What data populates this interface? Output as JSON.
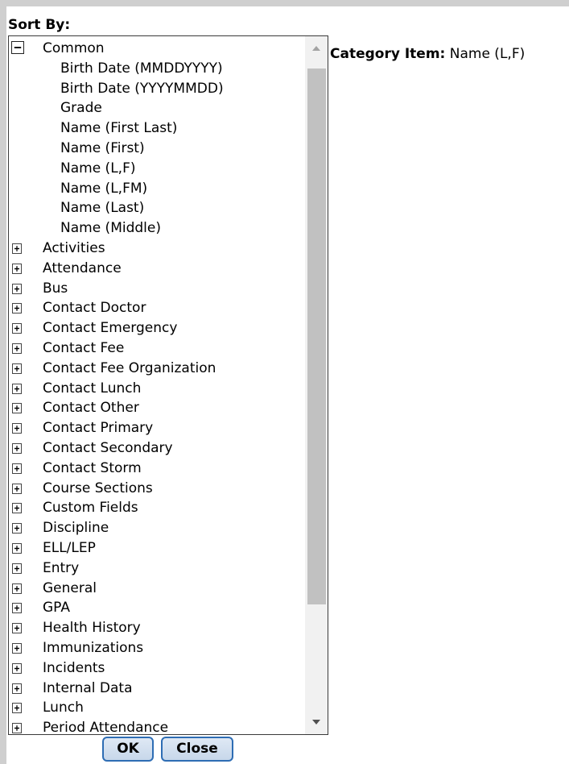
{
  "sort_by": {
    "label": "Sort By:"
  },
  "tree": {
    "expanded_category": "Common",
    "common_items": [
      "Birth Date (MMDDYYYY)",
      "Birth Date (YYYYMMDD)",
      "Grade",
      "Name (First Last)",
      "Name (First)",
      "Name (L,F)",
      "Name (L,FM)",
      "Name (Last)",
      "Name (Middle)"
    ],
    "collapsed_categories": [
      "Activities",
      "Attendance",
      "Bus",
      "Contact Doctor",
      "Contact Emergency",
      "Contact Fee",
      "Contact Fee Organization",
      "Contact Lunch",
      "Contact Other",
      "Contact Primary",
      "Contact Secondary",
      "Contact Storm",
      "Course Sections",
      "Custom Fields",
      "Discipline",
      "ELL/LEP",
      "Entry",
      "General",
      "GPA",
      "Health History",
      "Immunizations",
      "Incidents",
      "Internal Data",
      "Lunch",
      "Period Attendance"
    ],
    "icons": {
      "expanded": "minus-box-icon",
      "collapsed": "plus-box-icon"
    }
  },
  "category_item": {
    "label": "Category Item:",
    "value": "Name (L,F)"
  },
  "buttons": {
    "ok": "OK",
    "close": "Close"
  },
  "colors": {
    "button_border": "#2e6db4",
    "scroll_thumb": "#c1c1c1",
    "scroll_track": "#f1f1f1"
  }
}
